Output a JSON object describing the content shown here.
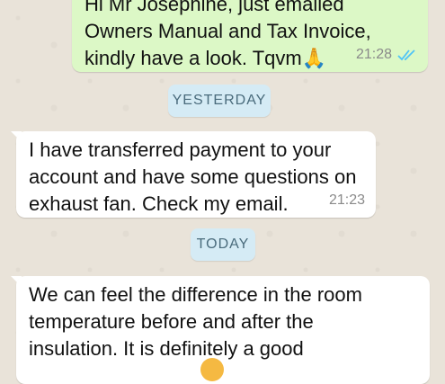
{
  "colors": {
    "outgoing_bubble": "#dcf8c6",
    "incoming_bubble": "#ffffff",
    "chat_background": "#e9e3d9",
    "date_chip": "#d5ebf5",
    "read_ticks": "#4fc3f7"
  },
  "messages": [
    {
      "direction": "outgoing",
      "text": "Hi Mr Josephine, just emailed\nOwners Manual and Tax Invoice,\nkindly have a look. Tqvm🙏",
      "time": "21:28",
      "status_icon": "double-check-read-icon"
    },
    {
      "direction": "incoming",
      "text": "I have transferred payment to your\naccount and have some questions on\nexhaust fan. Check my email.",
      "time": "21:23"
    },
    {
      "direction": "outgoing",
      "text": "We can feel the difference in the room\ntemperature before and after the\ninsulation. It is definitely a good",
      "time": ""
    }
  ],
  "date_separators": [
    {
      "label": "YESTERDAY"
    },
    {
      "label": "TODAY"
    }
  ]
}
